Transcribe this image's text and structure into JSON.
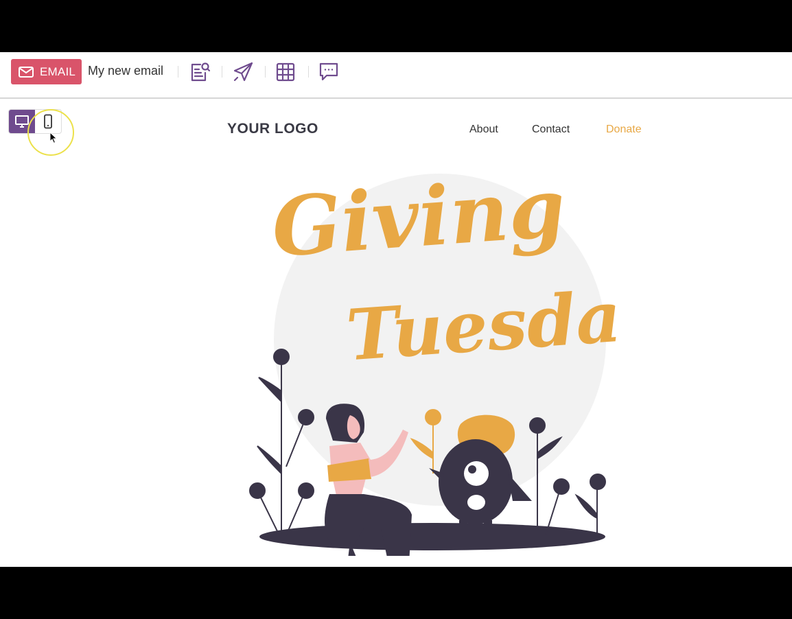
{
  "toolbar": {
    "email_badge_label": "EMAIL",
    "email_name": "My new email",
    "tools": [
      "document-search-icon",
      "paper-plane-icon",
      "grid-icon",
      "chat-bubble-icon"
    ]
  },
  "device_toggle": {
    "options": [
      "desktop-icon",
      "mobile-icon"
    ],
    "active": "desktop"
  },
  "email_content": {
    "logo": "YOUR LOGO",
    "nav": {
      "about": "About",
      "contact": "Contact",
      "donate": "Donate"
    },
    "hero_title_line1": "Giving",
    "hero_title_line2": "Tuesday"
  },
  "colors": {
    "brand_purple": "#6f4b8e",
    "email_badge": "#d9546a",
    "accent_orange": "#e8a845",
    "dark_figure": "#3a3548"
  }
}
